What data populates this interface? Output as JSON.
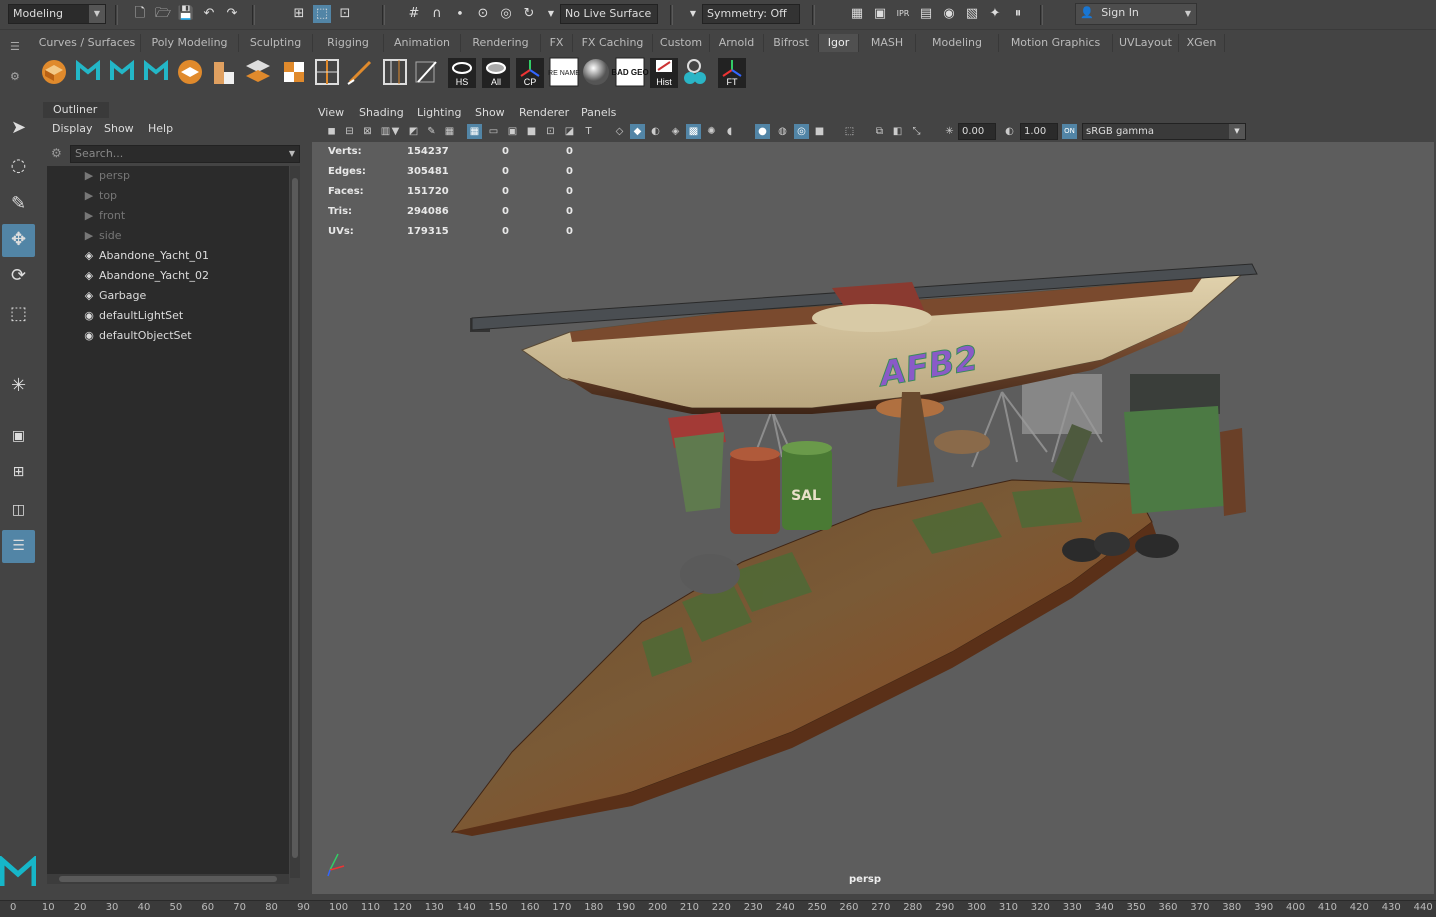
{
  "menu_set": {
    "selected": "Modeling"
  },
  "live_surface": "No Live Surface",
  "symmetry": "Symmetry: Off",
  "sign_in": "Sign In",
  "shelf_tabs": [
    {
      "label": "Curves / Surfaces",
      "active": false
    },
    {
      "label": "Poly Modeling",
      "active": false
    },
    {
      "label": "Sculpting",
      "active": false
    },
    {
      "label": "Rigging",
      "active": false
    },
    {
      "label": "Animation",
      "active": false
    },
    {
      "label": "Rendering",
      "active": false
    },
    {
      "label": "FX",
      "active": false
    },
    {
      "label": "FX Caching",
      "active": false
    },
    {
      "label": "Custom",
      "active": false
    },
    {
      "label": "Arnold",
      "active": false
    },
    {
      "label": "Bifrost",
      "active": false
    },
    {
      "label": "Igor",
      "active": true
    },
    {
      "label": "MASH",
      "active": false
    },
    {
      "label": "Modeling",
      "active": false
    },
    {
      "label": "Motion Graphics",
      "active": false
    },
    {
      "label": "UVLayout",
      "active": false
    },
    {
      "label": "XGen",
      "active": false
    }
  ],
  "shelf_labels": {
    "hs": "HS",
    "all": "All",
    "cp": "CP",
    "rename": "RE NAME",
    "badgeo": "BAD GEO",
    "hist": "Hist",
    "ft": "FT"
  },
  "outliner": {
    "title": "Outliner",
    "menu": [
      "Display",
      "Show",
      "Help"
    ],
    "search_placeholder": "Search...",
    "items": [
      {
        "label": "persp",
        "icon": "camera-icon",
        "dim": true
      },
      {
        "label": "top",
        "icon": "camera-icon",
        "dim": true
      },
      {
        "label": "front",
        "icon": "camera-icon",
        "dim": true
      },
      {
        "label": "side",
        "icon": "camera-icon",
        "dim": true
      },
      {
        "label": "Abandone_Yacht_01",
        "icon": "transform-icon",
        "dim": false
      },
      {
        "label": "Abandone_Yacht_02",
        "icon": "transform-icon",
        "dim": false
      },
      {
        "label": "Garbage",
        "icon": "transform-icon",
        "dim": false
      },
      {
        "label": "defaultLightSet",
        "icon": "set-icon",
        "dim": false
      },
      {
        "label": "defaultObjectSet",
        "icon": "set-icon",
        "dim": false
      }
    ]
  },
  "viewport": {
    "menu": [
      "View",
      "Shading",
      "Lighting",
      "Show",
      "Renderer",
      "Panels"
    ],
    "exposure": "0.00",
    "gamma": "1.00",
    "color_space": "sRGB gamma",
    "camera": "persp",
    "hud": [
      {
        "label": "Verts:",
        "v1": "154237",
        "v2": "0",
        "v3": "0"
      },
      {
        "label": "Edges:",
        "v1": "305481",
        "v2": "0",
        "v3": "0"
      },
      {
        "label": "Faces:",
        "v1": "151720",
        "v2": "0",
        "v3": "0"
      },
      {
        "label": "Tris:",
        "v1": "294086",
        "v2": "0",
        "v3": "0"
      },
      {
        "label": "UVs:",
        "v1": "179315",
        "v2": "0",
        "v3": "0"
      }
    ],
    "barrel_text": "SAL"
  },
  "timeline_ticks": [
    "0",
    "10",
    "20",
    "30",
    "40",
    "50",
    "60",
    "70",
    "80",
    "90",
    "100",
    "110",
    "120",
    "130",
    "140",
    "150",
    "160",
    "170",
    "180",
    "190",
    "200",
    "210",
    "220",
    "230",
    "240",
    "250",
    "260",
    "270",
    "280",
    "290",
    "300",
    "310",
    "320",
    "330",
    "340",
    "350",
    "360",
    "370",
    "380",
    "390",
    "400",
    "410",
    "420",
    "430",
    "440"
  ],
  "colors": {
    "accent": "#5285a6",
    "bg": "#444444",
    "viewport_bg": "#5d5d5d",
    "field_bg": "#2b2b2b"
  }
}
